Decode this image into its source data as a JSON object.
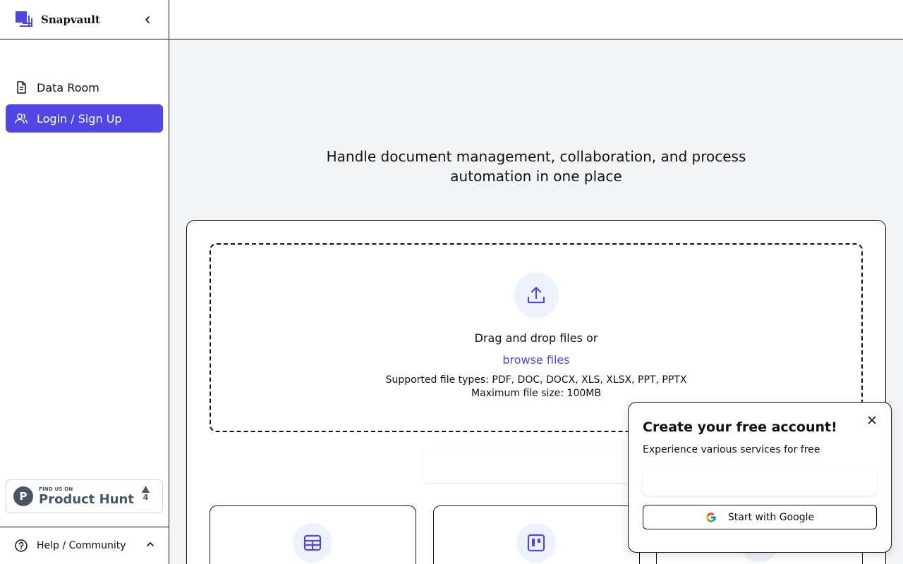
{
  "brand": {
    "name": "Snapvault"
  },
  "nav": {
    "items": [
      {
        "label": "Data Room",
        "icon": "document-icon",
        "active": false
      },
      {
        "label": "Login / Sign Up",
        "icon": "users-icon",
        "active": true
      }
    ]
  },
  "product_hunt": {
    "small_text": "FIND US ON",
    "big_text": "Product Hunt",
    "votes": "4"
  },
  "help": {
    "label": "Help / Community"
  },
  "main": {
    "headline": "Handle document management, collaboration, and process automation in one place",
    "dropzone": {
      "title": "Drag and drop files or",
      "link": "browse files",
      "types": "Supported file types: PDF, DOC, DOCX, XLS, XLSX, PPT, PPTX",
      "size": "Maximum file size: 100MB"
    }
  },
  "popup": {
    "title": "Create your free account!",
    "subtitle": "Experience various services for free",
    "input_value": "",
    "google_label": "Start with Google"
  },
  "colors": {
    "accent": "#4f46e5",
    "accent_light": "#eef2ff"
  }
}
